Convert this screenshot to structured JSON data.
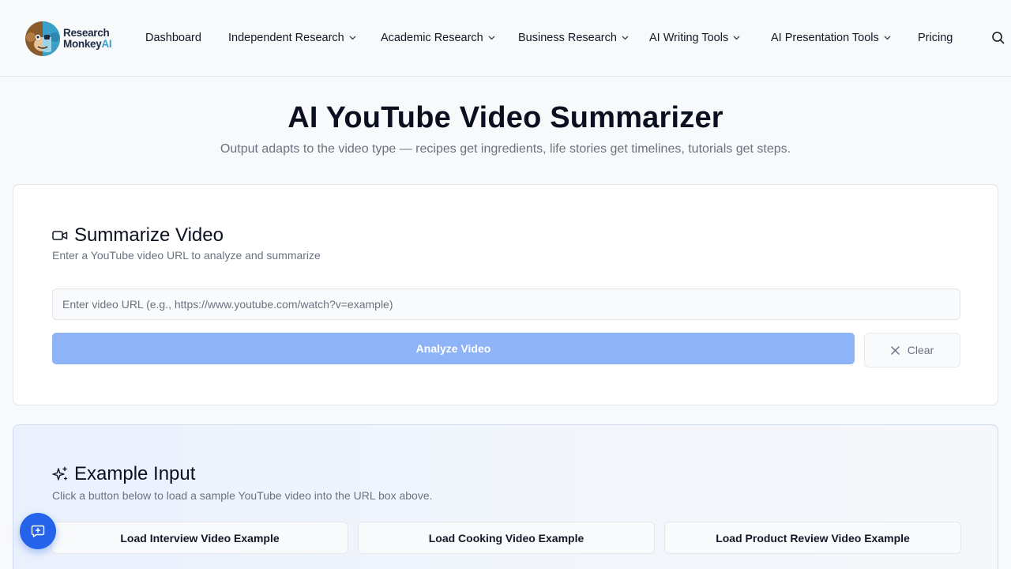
{
  "brand": {
    "line1": "Research",
    "line2": "Monkey",
    "line3": "AI",
    "logo_icon": "monkey-robot-logo"
  },
  "nav": {
    "items": [
      {
        "label": "Dashboard",
        "dropdown": false
      },
      {
        "label": "Independent Research",
        "dropdown": true
      },
      {
        "label": "Academic Research",
        "dropdown": true
      },
      {
        "label": "Business Research",
        "dropdown": true
      },
      {
        "label": "AI Writing Tools",
        "dropdown": true
      },
      {
        "label": "AI Presentation Tools",
        "dropdown": true
      },
      {
        "label": "Pricing",
        "dropdown": false
      }
    ],
    "search_icon": "search-icon"
  },
  "page": {
    "title": "AI YouTube Video Summarizer",
    "subtitle": "Output adapts to the video type — recipes get ingredients, life stories get timelines, tutorials get steps."
  },
  "summarize": {
    "icon": "video-camera-icon",
    "title": "Summarize Video",
    "description": "Enter a YouTube video URL to analyze and summarize",
    "input_placeholder": "Enter video URL (e.g., https://www.youtube.com/watch?v=example)",
    "input_value": "",
    "analyze_label": "Analyze Video",
    "clear_label": "Clear"
  },
  "examples": {
    "icon": "sparkles-icon",
    "title": "Example Input",
    "description": "Click a button below to load a sample YouTube video into the URL box above.",
    "buttons": [
      "Load Interview Video Example",
      "Load Cooking Video Example",
      "Load Product Review Video Example"
    ]
  },
  "colors": {
    "primary": "#2563eb",
    "analyze_disabled": "#8eb3f7",
    "background": "#f8f9fa"
  },
  "fab": {
    "icon": "chat-plus-icon"
  }
}
